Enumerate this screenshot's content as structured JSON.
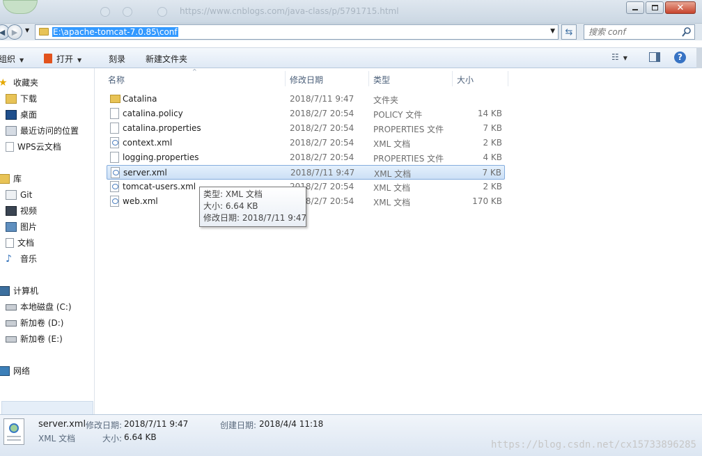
{
  "window": {
    "faded_url": "https://www.cnblogs.com/java-class/p/5791715.html"
  },
  "address": {
    "path": "E:\\apache-tomcat-7.0.85\\conf"
  },
  "search": {
    "placeholder": "搜索 conf"
  },
  "toolbar": {
    "organize": "组织",
    "open": "打开",
    "burn": "刻录",
    "new_folder": "新建文件夹"
  },
  "sidebar": {
    "favorites": {
      "label": "收藏夹",
      "items": [
        "下载",
        "桌面",
        "最近访问的位置",
        "WPS云文档"
      ]
    },
    "libraries": {
      "label": "库",
      "items": [
        "Git",
        "视频",
        "图片",
        "文档",
        "音乐"
      ]
    },
    "computer": {
      "label": "计算机",
      "items": [
        "本地磁盘 (C:)",
        "新加卷 (D:)",
        "新加卷 (E:)"
      ]
    },
    "network": {
      "label": "网络"
    }
  },
  "columns": {
    "name": "名称",
    "modified": "修改日期",
    "type": "类型",
    "size": "大小"
  },
  "files": [
    {
      "name": "Catalina",
      "modified": "2018/7/11 9:47",
      "type": "文件夹",
      "size": "",
      "icon": "folder-icon"
    },
    {
      "name": "catalina.policy",
      "modified": "2018/2/7 20:54",
      "type": "POLICY 文件",
      "size": "14 KB",
      "icon": "file-icon"
    },
    {
      "name": "catalina.properties",
      "modified": "2018/2/7 20:54",
      "type": "PROPERTIES 文件",
      "size": "7 KB",
      "icon": "file-icon"
    },
    {
      "name": "context.xml",
      "modified": "2018/2/7 20:54",
      "type": "XML 文档",
      "size": "2 KB",
      "icon": "xml-icon"
    },
    {
      "name": "logging.properties",
      "modified": "2018/2/7 20:54",
      "type": "PROPERTIES 文件",
      "size": "4 KB",
      "icon": "file-icon"
    },
    {
      "name": "server.xml",
      "modified": "2018/7/11 9:47",
      "type": "XML 文档",
      "size": "7 KB",
      "icon": "xml-icon",
      "selected": true
    },
    {
      "name": "tomcat-users.xml",
      "modified": "2018/2/7 20:54",
      "type": "XML 文档",
      "size": "2 KB",
      "icon": "xml-icon"
    },
    {
      "name": "web.xml",
      "modified": "2018/2/7 20:54",
      "type": "XML 文档",
      "size": "170 KB",
      "icon": "xml-icon"
    }
  ],
  "tooltip": {
    "type": "类型: XML 文档",
    "size": "大小: 6.64 KB",
    "modified": "修改日期: 2018/7/11 9:47"
  },
  "details": {
    "name": "server.xml",
    "modified_label": "修改日期:",
    "modified_value": "2018/7/11 9:47",
    "created_label": "创建日期:",
    "created_value": "2018/4/4 11:18",
    "type": "XML 文档",
    "size_label": "大小:",
    "size_value": "6.64 KB"
  },
  "watermark": "https://blog.csdn.net/cx15733896285",
  "colors": {
    "selection": "#3399ff",
    "row_selected": "#cce0f6",
    "folder": "#e8c356"
  }
}
